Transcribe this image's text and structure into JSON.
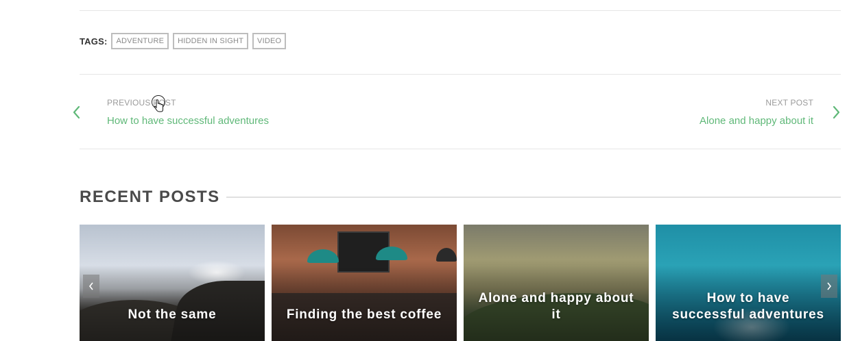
{
  "tags": {
    "label": "TAGS:",
    "items": [
      "ADVENTURE",
      "HIDDEN IN SIGHT",
      "VIDEO"
    ]
  },
  "post_nav": {
    "prev": {
      "kicker": "PREVIOUS POST",
      "title": "How to have successful adventures"
    },
    "next": {
      "kicker": "NEXT POST",
      "title": "Alone and happy about it"
    }
  },
  "recent": {
    "title": "RECENT POSTS",
    "cards": [
      {
        "title": "Not the same"
      },
      {
        "title": "Finding the best coffee"
      },
      {
        "title": "Alone and happy about it"
      },
      {
        "title": "How to have successful adventures"
      }
    ]
  },
  "colors": {
    "accent": "#5fb878",
    "heading": "#4a4a4a",
    "tag_border": "#bdbdbd"
  },
  "icons": {
    "prev_post": "chevron-left-icon",
    "next_post": "chevron-right-icon",
    "carousel_prev": "chevron-left-icon",
    "carousel_next": "chevron-right-icon",
    "cursor": "hand-pointer-cursor-icon"
  }
}
